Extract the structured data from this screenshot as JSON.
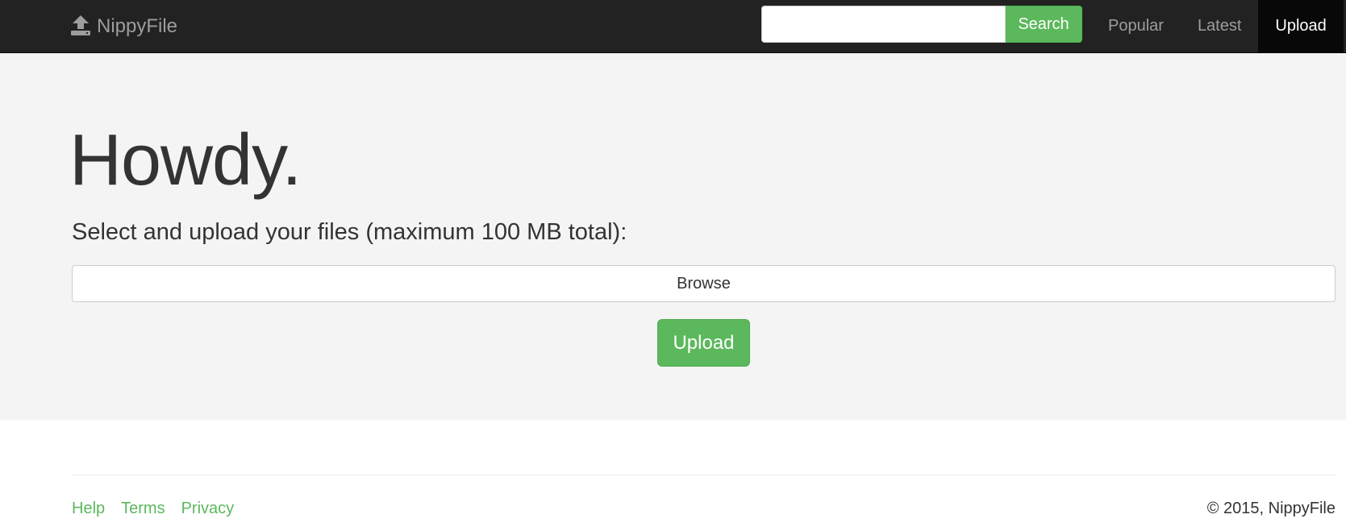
{
  "navbar": {
    "brand": "NippyFile",
    "brand_icon": "upload-icon",
    "search": {
      "placeholder": "",
      "value": "",
      "button_label": "Search"
    },
    "links": [
      {
        "label": "Popular",
        "active": false
      },
      {
        "label": "Latest",
        "active": false
      },
      {
        "label": "Upload",
        "active": true
      }
    ]
  },
  "hero": {
    "title": "Howdy.",
    "subtitle": "Select and upload your files (maximum 100 MB total):",
    "browse_label": "Browse",
    "upload_label": "Upload"
  },
  "footer": {
    "links": [
      {
        "label": "Help"
      },
      {
        "label": "Terms"
      },
      {
        "label": "Privacy"
      }
    ],
    "copyright": "© 2015, NippyFile"
  },
  "colors": {
    "navbar_bg": "#222222",
    "active_tab_bg": "#080808",
    "accent_green": "#5cb85c",
    "jumbotron_bg": "#f4f4f4"
  }
}
